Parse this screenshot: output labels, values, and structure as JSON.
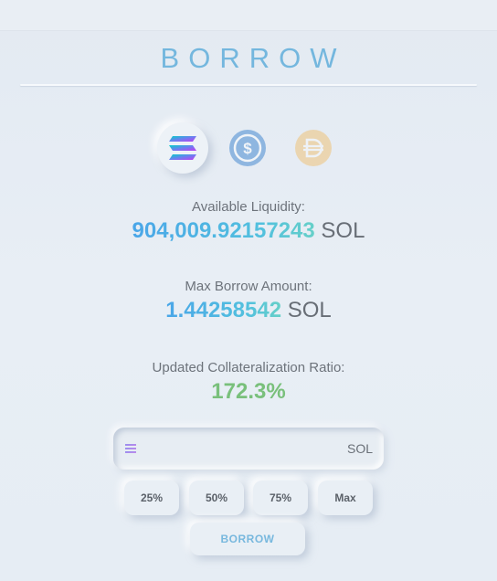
{
  "header": {
    "title": "BORROW"
  },
  "tokens": [
    {
      "icon": "solana-icon",
      "selected": true
    },
    {
      "icon": "usdc-icon",
      "selected": false
    },
    {
      "icon": "dai-icon",
      "selected": false
    }
  ],
  "available_liquidity": {
    "label": "Available Liquidity:",
    "value": "904,009.92157243",
    "unit": "SOL"
  },
  "max_borrow": {
    "label": "Max Borrow Amount:",
    "value": "1.44258542",
    "unit": "SOL"
  },
  "collateral_ratio": {
    "label": "Updated Collateralization Ratio:",
    "value": "172.3%"
  },
  "amount_input": {
    "value": "",
    "placeholder": "",
    "unit": "SOL"
  },
  "percent_buttons": [
    "25%",
    "50%",
    "75%",
    "Max"
  ],
  "submit": {
    "label": "BORROW"
  },
  "colors": {
    "accent": "#74b7de",
    "ratio": "#79c07b",
    "background": "#e6edf4"
  }
}
